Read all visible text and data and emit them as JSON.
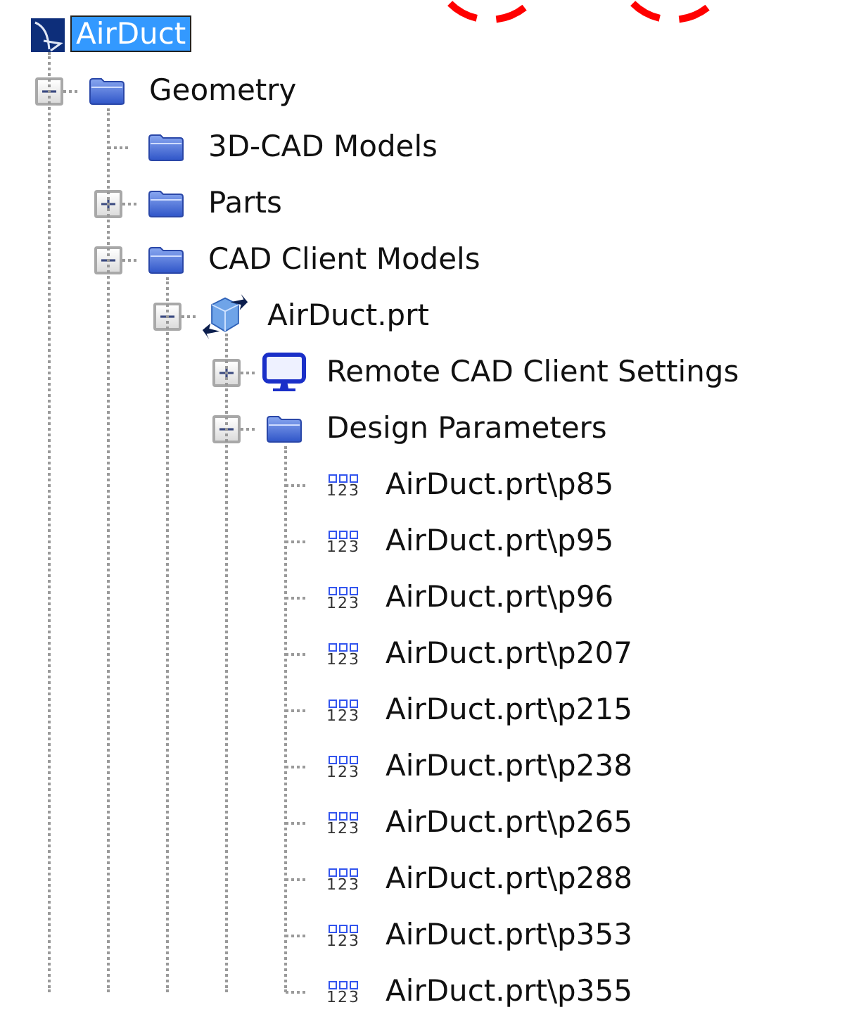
{
  "annotations": [
    {
      "kind": "circle",
      "color": "#ff0000"
    },
    {
      "kind": "circle",
      "color": "#ff0000"
    }
  ],
  "tree": {
    "label": "AirDuct",
    "kind": "app",
    "selected": true,
    "children": [
      {
        "label": "Geometry",
        "kind": "folder",
        "selected": false,
        "expanded": true,
        "children": [
          {
            "label": "3D-CAD Models",
            "kind": "folder",
            "selected": false
          },
          {
            "label": "Parts",
            "kind": "folder",
            "selected": false,
            "expanded": false
          },
          {
            "label": "CAD Client Models",
            "kind": "folder",
            "selected": false,
            "expanded": true,
            "children": [
              {
                "label": "AirDuct.prt",
                "kind": "part",
                "selected": false,
                "expanded": true,
                "children": [
                  {
                    "label": "Remote CAD Client Settings",
                    "kind": "monitor",
                    "selected": false,
                    "expanded": false
                  },
                  {
                    "label": "Design Parameters",
                    "kind": "folder",
                    "selected": false,
                    "expanded": true,
                    "children": [
                      {
                        "label": "AirDuct.prt\\p85",
                        "kind": "parameter",
                        "icon_text": "123",
                        "selected": false
                      },
                      {
                        "label": "AirDuct.prt\\p95",
                        "kind": "parameter",
                        "icon_text": "123",
                        "selected": false
                      },
                      {
                        "label": "AirDuct.prt\\p96",
                        "kind": "parameter",
                        "icon_text": "123",
                        "selected": false
                      },
                      {
                        "label": "AirDuct.prt\\p207",
                        "kind": "parameter",
                        "icon_text": "123",
                        "selected": false
                      },
                      {
                        "label": "AirDuct.prt\\p215",
                        "kind": "parameter",
                        "icon_text": "123",
                        "selected": false
                      },
                      {
                        "label": "AirDuct.prt\\p238",
                        "kind": "parameter",
                        "icon_text": "123",
                        "selected": false
                      },
                      {
                        "label": "AirDuct.prt\\p265",
                        "kind": "parameter",
                        "icon_text": "123",
                        "selected": false
                      },
                      {
                        "label": "AirDuct.prt\\p288",
                        "kind": "parameter",
                        "icon_text": "123",
                        "selected": false
                      },
                      {
                        "label": "AirDuct.prt\\p353",
                        "kind": "parameter",
                        "icon_text": "123",
                        "selected": false
                      },
                      {
                        "label": "AirDuct.prt\\p355",
                        "kind": "parameter",
                        "icon_text": "123",
                        "selected": false
                      }
                    ]
                  }
                ]
              }
            ]
          }
        ]
      }
    ]
  }
}
